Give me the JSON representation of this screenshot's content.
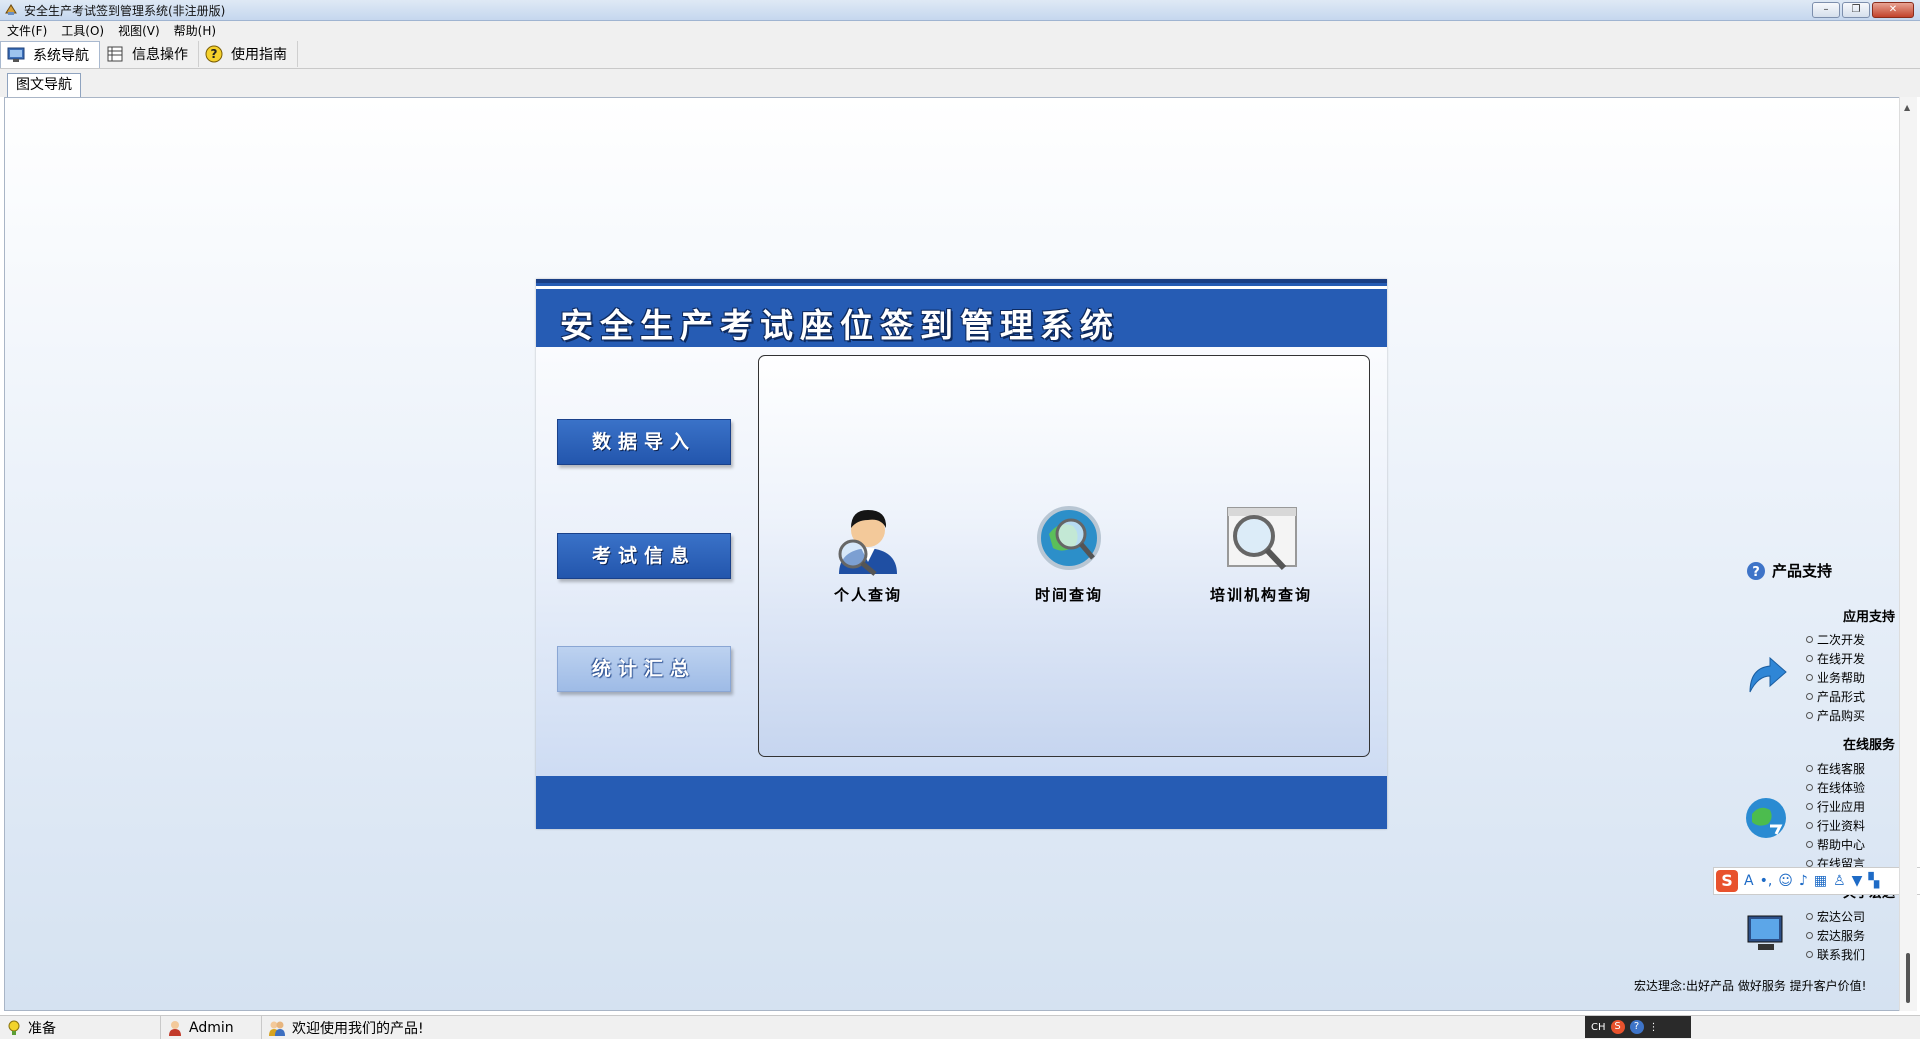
{
  "window": {
    "title": "安全生产考试签到管理系统(非注册版)"
  },
  "menu": [
    "文件(F)",
    "工具(O)",
    "视图(V)",
    "帮助(H)"
  ],
  "toolbar": {
    "nav": "系统导航",
    "info": "信息操作",
    "guide": "使用指南"
  },
  "tab": {
    "label": "图文导航"
  },
  "panel": {
    "title": "安全生产考试座位签到管理系统",
    "buttons": [
      "数据导入",
      "考试信息",
      "统计汇总"
    ],
    "queries": [
      "个人查询",
      "时间查询",
      "培训机构查询"
    ]
  },
  "support": {
    "title": "产品支持",
    "sections": [
      {
        "title": "应用支持",
        "links": [
          "二次开发",
          "在线开发",
          "业务帮助",
          "产品形式",
          "产品购买"
        ]
      },
      {
        "title": "在线服务",
        "links": [
          "在线客服",
          "在线体验",
          "行业应用",
          "行业资料",
          "帮助中心",
          "在线留言"
        ]
      },
      {
        "title": "关于宏达",
        "links": [
          "宏达公司",
          "宏达服务",
          "联系我们"
        ]
      }
    ],
    "slogan": "宏达理念:出好产品 做好服务 提升客户价值!"
  },
  "status": {
    "ready": "准备",
    "user": "Admin",
    "welcome": "欢迎使用我们的产品!"
  },
  "tray": {
    "lang": "CH"
  },
  "colors": {
    "header_blue": "#265cb4",
    "content_bg": "#e6eef8"
  }
}
